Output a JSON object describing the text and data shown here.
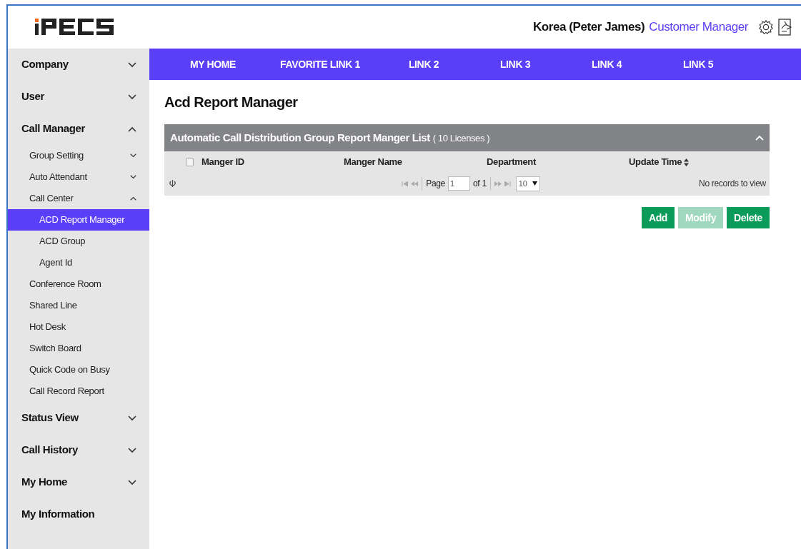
{
  "header": {
    "user": "Korea (Peter James)",
    "role": "Customer Manager"
  },
  "sidebar": {
    "items": [
      {
        "label": "Company",
        "kind": "group",
        "expanded": false
      },
      {
        "label": "User",
        "kind": "group",
        "expanded": false
      },
      {
        "label": "Call Manager",
        "kind": "group",
        "expanded": true,
        "children": [
          {
            "label": "Group Setting",
            "kind": "group",
            "expanded": false
          },
          {
            "label": "Auto Attendant",
            "kind": "group",
            "expanded": false
          },
          {
            "label": "Call Center",
            "kind": "group",
            "expanded": true,
            "children": [
              {
                "label": "ACD Report Manager",
                "kind": "link",
                "selected": true
              },
              {
                "label": "ACD Group",
                "kind": "link",
                "selected": false
              },
              {
                "label": "Agent Id",
                "kind": "link",
                "selected": false
              }
            ]
          },
          {
            "label": "Conference Room",
            "kind": "link",
            "selected": false
          },
          {
            "label": "Shared Line",
            "kind": "link",
            "selected": false
          },
          {
            "label": "Hot Desk",
            "kind": "link",
            "selected": false
          },
          {
            "label": "Switch Board",
            "kind": "link",
            "selected": false
          },
          {
            "label": "Quick Code on Busy",
            "kind": "link",
            "selected": false
          },
          {
            "label": "Call Record Report",
            "kind": "link",
            "selected": false
          }
        ]
      },
      {
        "label": "Status View",
        "kind": "group",
        "expanded": false
      },
      {
        "label": "Call History",
        "kind": "group",
        "expanded": false
      },
      {
        "label": "My Home",
        "kind": "group",
        "expanded": false
      },
      {
        "label": "My Information",
        "kind": "link",
        "selected": false
      }
    ]
  },
  "nav": [
    "MY HOME",
    "FAVORITE LINK 1",
    "LINK 2",
    "LINK 3",
    "LINK 4",
    "LINK 5"
  ],
  "page_title": "Acd Report Manager",
  "panel": {
    "select_all": {
      "checked": false
    },
    "title": "Automatic Call Distribution Group Report Manger List",
    "count": "( 10 Licenses )",
    "expanded": true,
    "columns": [
      "Manger ID",
      "Manger Name",
      "Department",
      "Update Time"
    ],
    "pager": {
      "page_label": "Page",
      "page": "1",
      "of": "of 1",
      "rows": "10",
      "status": "No records to view"
    }
  },
  "buttons": [
    {
      "label": "Add",
      "disabled": false
    },
    {
      "label": "Modify",
      "disabled": true
    },
    {
      "label": "Delete",
      "disabled": false
    }
  ]
}
